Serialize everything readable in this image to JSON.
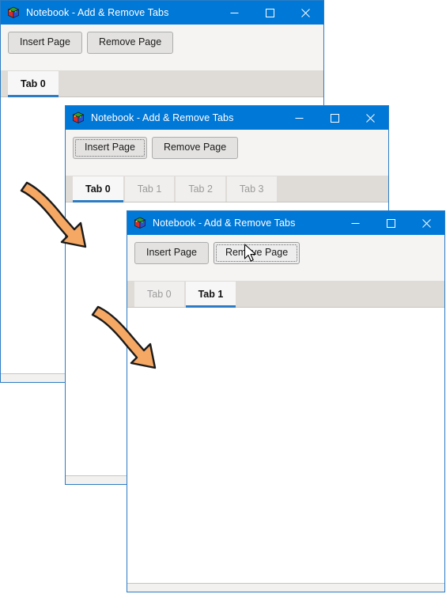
{
  "app": {
    "title": "Notebook - Add & Remove Tabs",
    "icon": "wx-cube-icon",
    "accent_color": "#0078D7",
    "tab_underline_color": "#2B7CC4",
    "toolbar_bg": "#F5F4F2",
    "tabstrip_bg": "#DFDCD8",
    "annotation_arrow_color": "#F5A764"
  },
  "window_controls": {
    "minimize": "minimize-icon",
    "maximize": "maximize-icon",
    "close": "close-icon",
    "minimize_label": "Minimize",
    "maximize_label": "Maximize",
    "close_label": "Close"
  },
  "toolbar": {
    "insert_label": "Insert Page",
    "remove_label": "Remove Page"
  },
  "windows": [
    {
      "id": "window-step-1",
      "title": "Notebook - Add & Remove Tabs",
      "focused_button": null,
      "hovered_button": null,
      "tabs": [
        {
          "label": "Tab 0",
          "active": true
        }
      ]
    },
    {
      "id": "window-step-2",
      "title": "Notebook - Add & Remove Tabs",
      "focused_button": "insert",
      "hovered_button": null,
      "tabs": [
        {
          "label": "Tab 0",
          "active": true
        },
        {
          "label": "Tab 1",
          "active": false
        },
        {
          "label": "Tab 2",
          "active": false
        },
        {
          "label": "Tab 3",
          "active": false
        }
      ]
    },
    {
      "id": "window-step-3",
      "title": "Notebook - Add & Remove Tabs",
      "focused_button": "remove",
      "hovered_button": "remove",
      "tabs": [
        {
          "label": "Tab 0",
          "active": false
        },
        {
          "label": "Tab 1",
          "active": true
        }
      ]
    }
  ],
  "annotations": {
    "arrow_1": "flow-arrow-step1-to-step2",
    "arrow_2": "flow-arrow-step2-to-step3",
    "cursor": "mouse-pointer"
  }
}
